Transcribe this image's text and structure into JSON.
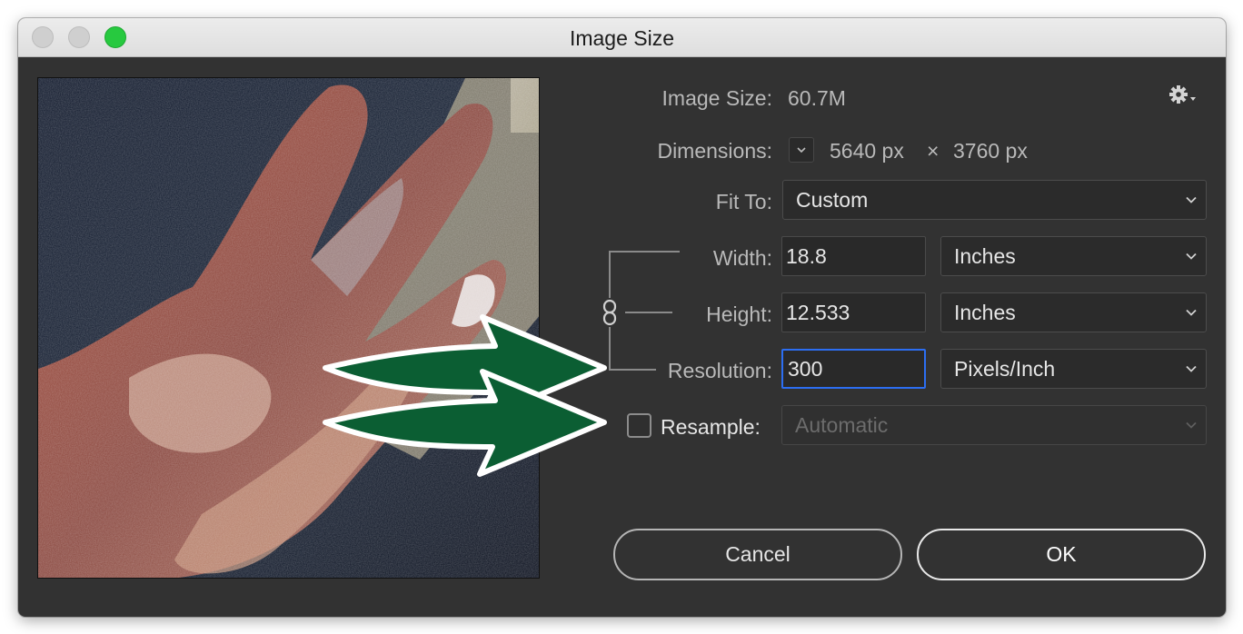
{
  "window": {
    "title": "Image Size"
  },
  "info": {
    "image_size_label": "Image Size:",
    "image_size_value": "60.7M",
    "dimensions_label": "Dimensions:",
    "dim_width": "5640 px",
    "dim_times": "×",
    "dim_height": "3760 px"
  },
  "fit_to": {
    "label": "Fit To:",
    "value": "Custom"
  },
  "width": {
    "label": "Width:",
    "value": "18.8",
    "unit": "Inches"
  },
  "height": {
    "label": "Height:",
    "value": "12.533",
    "unit": "Inches"
  },
  "resolution": {
    "label": "Resolution:",
    "value": "300",
    "unit": "Pixels/Inch"
  },
  "resample": {
    "label": "Resample:",
    "checked": false,
    "value": "Automatic"
  },
  "buttons": {
    "cancel": "Cancel",
    "ok": "OK"
  },
  "icons": {
    "gear": "gear-icon",
    "link": "link-chain-icon",
    "chevron": "chevron-down-icon",
    "arrow": "arrow-right-icon"
  },
  "colors": {
    "dialog_bg": "#323232",
    "focus_ring": "#2c6ef2",
    "arrow_fill": "#0b5e33",
    "close_button": "#cfcfcf",
    "zoom_button": "#27c93f"
  }
}
